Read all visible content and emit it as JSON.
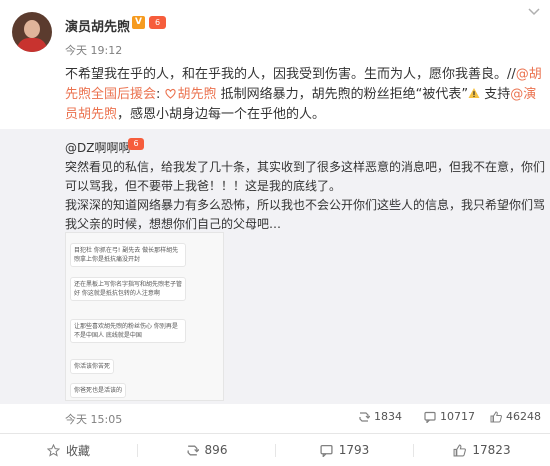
{
  "post": {
    "author": "演员胡先煦",
    "verified_badge": "V",
    "level_badge": "6",
    "timestamp": "今天 19:12",
    "text_1": "不希望我在乎的人，和在乎我的人，因我受到伤害。生而为人，愿你我善良。//",
    "mention_1": "@胡先煦全国后援会",
    "text_2": ": ",
    "super_topic": "胡先煦",
    "text_3": " 抵制网络暴力，胡先煦的粉丝拒绝“被代表”",
    "text_4": " 支持",
    "mention_2": "@演员胡先煦",
    "text_5": "，感恩小胡身边每一个在乎他的人。"
  },
  "quoted": {
    "author": "@DZ啊啊啊",
    "level_badge": "6",
    "text_1": "突然看见的私信，给我发了几十条，其实收到了很多这样恶意的消息吧，但我不在意，你们可以骂我，但不要带上我爸！！！这是我的底线了。",
    "text_2": "我深深的知道网络暴力有多么恐怖，所以我也不会公开你们这些人的信息，我只希望你们骂我父亲的时候，想想你们自己的父母吧…",
    "image_messages": [
      "目犯杜 你抓在弓! 副先去 做长那样胡先煦拿上你是抵抗痛没开封",
      "还在黑板上写你名字指写和胡先煦老子管好 你这就是抵抗包转的人注意啊",
      "让那些喜欢胡先煦的粉丝伤心 你别再是不是中国人 底线就是中国",
      "你活该你苦死",
      "你爸死也是活该的"
    ],
    "timestamp": "今天 15:05",
    "reposts": "1834",
    "comments": "10717",
    "likes": "46248"
  },
  "actions": {
    "favorite": "收藏",
    "repost": "896",
    "comment": "1793",
    "like": "17823"
  },
  "colors": {
    "link": "#eb7350",
    "quote_background": "#f2f2f5",
    "badge_orange": "#f69b1f",
    "badge_red": "#f65d3c"
  },
  "icons": {
    "favorite": "star-icon",
    "repost": "repost-icon",
    "comment": "comment-icon",
    "like": "thumbs-up-icon",
    "dropdown": "chevron-down-icon",
    "warning": "warning-icon"
  }
}
